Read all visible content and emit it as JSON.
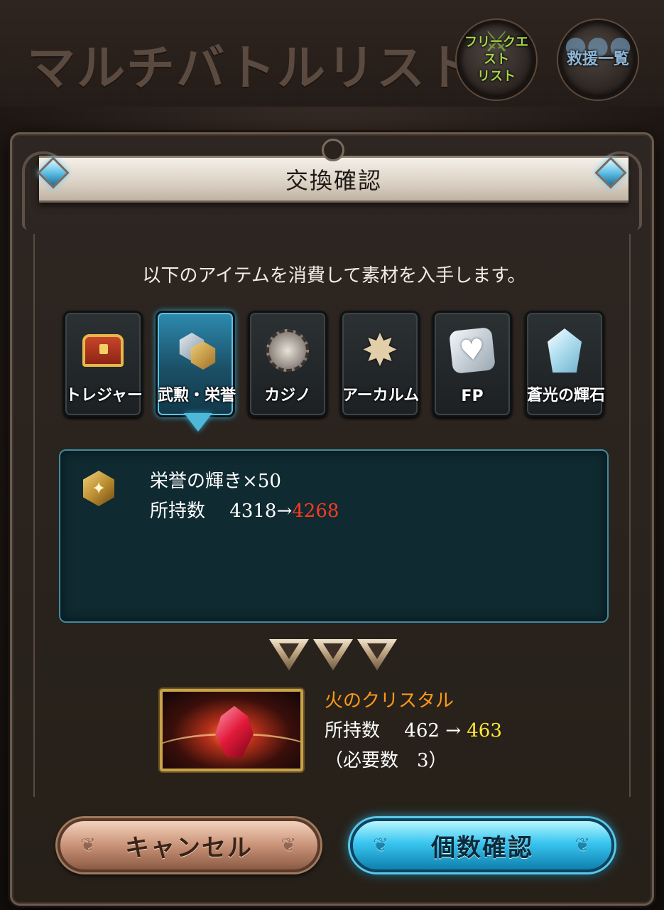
{
  "background": {
    "title": "マルチバトルリスト",
    "buttons": [
      {
        "label": "フリークエスト\nリスト",
        "icon": "sword-icon"
      },
      {
        "label": "救援一覧",
        "icon": "people-icon"
      }
    ]
  },
  "dialog": {
    "title": "交換確認",
    "message": "以下のアイテムを消費して素材を入手します。",
    "tabs": [
      {
        "label": "トレジャー",
        "icon": "treasure-chest-icon",
        "active": false
      },
      {
        "label": "武勲・栄誉",
        "icon": "honor-medal-icon",
        "active": true
      },
      {
        "label": "カジノ",
        "icon": "casino-chip-icon",
        "active": false
      },
      {
        "label": "アーカルム",
        "icon": "arcarum-star-icon",
        "active": false
      },
      {
        "label": "FP",
        "icon": "heart-fp-icon",
        "active": false
      },
      {
        "label": "蒼光の輝石",
        "icon": "crystal-icon",
        "active": false
      }
    ],
    "consume": {
      "name": "栄誉の輝き×50",
      "count_label": "所持数",
      "count_before": "4318",
      "count_arrow": "→",
      "count_after": "4268"
    },
    "reward": {
      "name": "火のクリスタル",
      "count_label": "所持数",
      "count_before": "462",
      "count_arrow": "→",
      "count_after": "463",
      "required_text": "（必要数　3）"
    },
    "buttons": {
      "cancel": "キャンセル",
      "confirm": "個数確認"
    }
  },
  "colors": {
    "accent_blue": "#39c6f0",
    "decrease_red": "#ff3a1f",
    "increase_yellow": "#ffe83a",
    "reward_orange": "#ff9a1a"
  }
}
